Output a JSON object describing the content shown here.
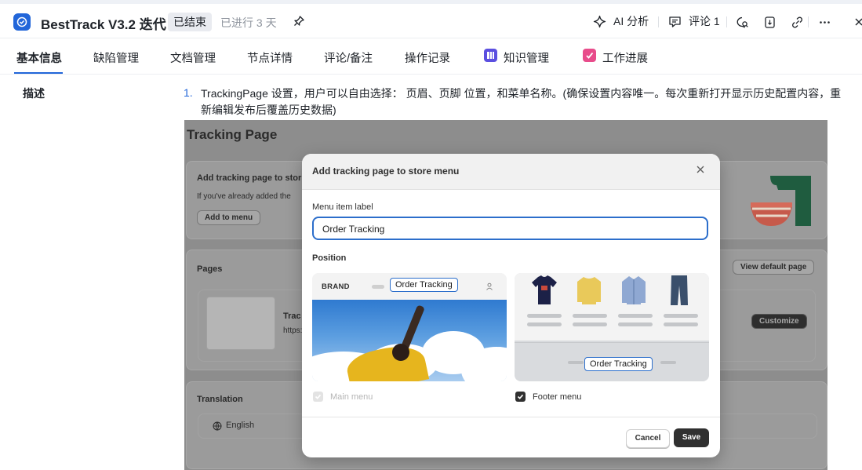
{
  "header": {
    "title": "BestTrack V3.2 迭代",
    "status": "已结束",
    "elapsed": "已进行 3 天",
    "ai_label": "AI 分析",
    "comment_label": "评论 1",
    "icons": [
      "pin-icon",
      "sparkle-icon",
      "comment-icon",
      "search-chat-icon",
      "export-icon",
      "link-icon",
      "more-icon",
      "close-icon"
    ]
  },
  "tabs": [
    {
      "label": "基本信息",
      "active": true
    },
    {
      "label": "缺陷管理"
    },
    {
      "label": "文档管理"
    },
    {
      "label": "节点详情"
    },
    {
      "label": "评论/备注"
    },
    {
      "label": "操作记录"
    },
    {
      "label": "知识管理",
      "icon_color": "#5b4fe0"
    },
    {
      "label": "工作进展",
      "icon_color": "#e84c8b"
    }
  ],
  "content": {
    "description_label": "描述",
    "item_number": "1.",
    "item_text": "TrackingPage 设置，用户可以自由选择： 页眉、页脚 位置，和菜单名称。(确保设置内容唯一。每次重新打开显示历史配置内容，重新编辑发布后覆盖历史数据)"
  },
  "screenshot": {
    "page_title": "Tracking Page",
    "card1_title": "Add tracking page to stor",
    "card1_text": "If you've already added the",
    "card1_button": "Add to menu",
    "pages_title": "Pages",
    "view_default": "View default page",
    "page_name": "Trac",
    "page_url": "https:/",
    "customize": "Customize",
    "translation_title": "Translation",
    "language": "English",
    "modal": {
      "title": "Add tracking page to store menu",
      "menu_label": "Menu item label",
      "menu_value": "Order Tracking",
      "position_label": "Position",
      "brand": "BRAND",
      "header_pill": "Order Tracking",
      "footer_pill": "Order Tracking",
      "main_menu": "Main menu",
      "main_menu_checked": true,
      "main_menu_disabled": true,
      "footer_menu": "Footer menu",
      "footer_menu_checked": true,
      "cancel": "Cancel",
      "save": "Save"
    }
  },
  "colors": {
    "accent": "#2266d9",
    "save_button": "#303030",
    "input_focus": "#2c6ecb"
  }
}
